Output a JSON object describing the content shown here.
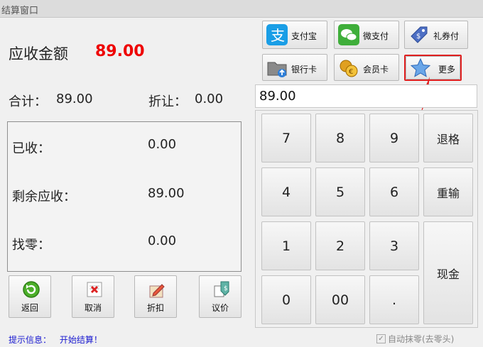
{
  "window": {
    "title": "结算窗口"
  },
  "summary": {
    "receivable_label": "应收金额",
    "receivable_value": "89.00",
    "total_label": "合计：",
    "total_value": "89.00",
    "discount_label": "折让：",
    "discount_value": "0.00"
  },
  "panel": {
    "received_label": "已收：",
    "received_value": "0.00",
    "remaining_label": "剩余应收：",
    "remaining_value": "89.00",
    "change_label": "找零：",
    "change_value": "0.00"
  },
  "actions": {
    "back": "返回",
    "cancel": "取消",
    "discount": "折扣",
    "negotiate": "议价"
  },
  "payments": {
    "alipay": "支付宝",
    "wechat": "微支付",
    "voucher": "礼券付",
    "bankcard": "银行卡",
    "member": "会员卡",
    "more": "更多"
  },
  "input": {
    "value": "89.00"
  },
  "keypad": {
    "k7": "7",
    "k8": "8",
    "k9": "9",
    "backspace": "退格",
    "k4": "4",
    "k5": "5",
    "k6": "6",
    "reenter": "重输",
    "k1": "1",
    "k2": "2",
    "k3": "3",
    "cash": "现金",
    "k0": "0",
    "k00": "00",
    "dot": "."
  },
  "status": {
    "prefix": "提示信息：",
    "message": "开始结算！",
    "auto_round_label": "自动抹零(去零头)",
    "auto_round_checked": true
  },
  "colors": {
    "amount": "#e00000",
    "highlight": "#e02020",
    "status_text": "#1a1ad0"
  }
}
